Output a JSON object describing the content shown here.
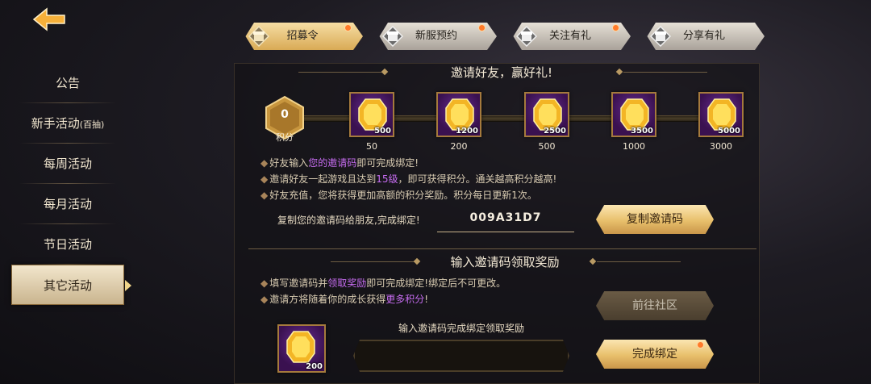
{
  "sidebar": {
    "items": [
      {
        "label": "公告"
      },
      {
        "label": "新手活动",
        "suffix": "(百抽)"
      },
      {
        "label": "每周活动"
      },
      {
        "label": "每月活动"
      },
      {
        "label": "节日活动"
      },
      {
        "label": "其它活动",
        "active": true
      }
    ]
  },
  "tabs": [
    {
      "label": "招募令",
      "active": true,
      "badge": true
    },
    {
      "label": "新服预约",
      "active": false,
      "badge": true
    },
    {
      "label": "关注有礼",
      "active": false,
      "badge": true
    },
    {
      "label": "分享有礼",
      "active": false,
      "badge": false
    }
  ],
  "invite_section": {
    "title": "邀请好友，赢好礼!",
    "points": {
      "value": "0",
      "label": "积分"
    },
    "rewards": [
      {
        "qty": "500",
        "milestone": "50"
      },
      {
        "qty": "1200",
        "milestone": "200"
      },
      {
        "qty": "2500",
        "milestone": "500"
      },
      {
        "qty": "3500",
        "milestone": "1000"
      },
      {
        "qty": "5000",
        "milestone": "3000"
      }
    ],
    "rules": [
      {
        "pre": "好友输入",
        "hl": "您的邀请码",
        "post": "即可完成绑定!"
      },
      {
        "pre": "邀请好友一起游戏且达到",
        "hl": "15级",
        "post": "，即可获得积分。通关越高积分越高!"
      },
      {
        "pre": "好友充值，您将获得更加高额的积分奖励。积分每日更新1次。",
        "hl": "",
        "post": ""
      }
    ],
    "code_label": "复制您的邀请码给朋友,完成绑定!",
    "code_value": "009A31D7",
    "copy_button": "复制邀请码"
  },
  "redeem_section": {
    "title": "输入邀请码领取奖励",
    "rules": [
      {
        "pre": "填写邀请码并",
        "hl": "领取奖励",
        "post": "即可完成绑定!绑定后不可更改。"
      },
      {
        "pre": "邀请方将随着你的成长获得",
        "hl": "更多积分",
        "post": "!"
      }
    ],
    "community_button": "前往社区",
    "reward_qty": "200",
    "input_caption": "输入邀请码完成绑定领取奖励",
    "input_value": "",
    "bind_button": "完成绑定"
  },
  "colors": {
    "accent_gold": "#e8bf6b",
    "highlight_purple": "#c66cf0",
    "badge_orange": "#ff7a2a"
  }
}
